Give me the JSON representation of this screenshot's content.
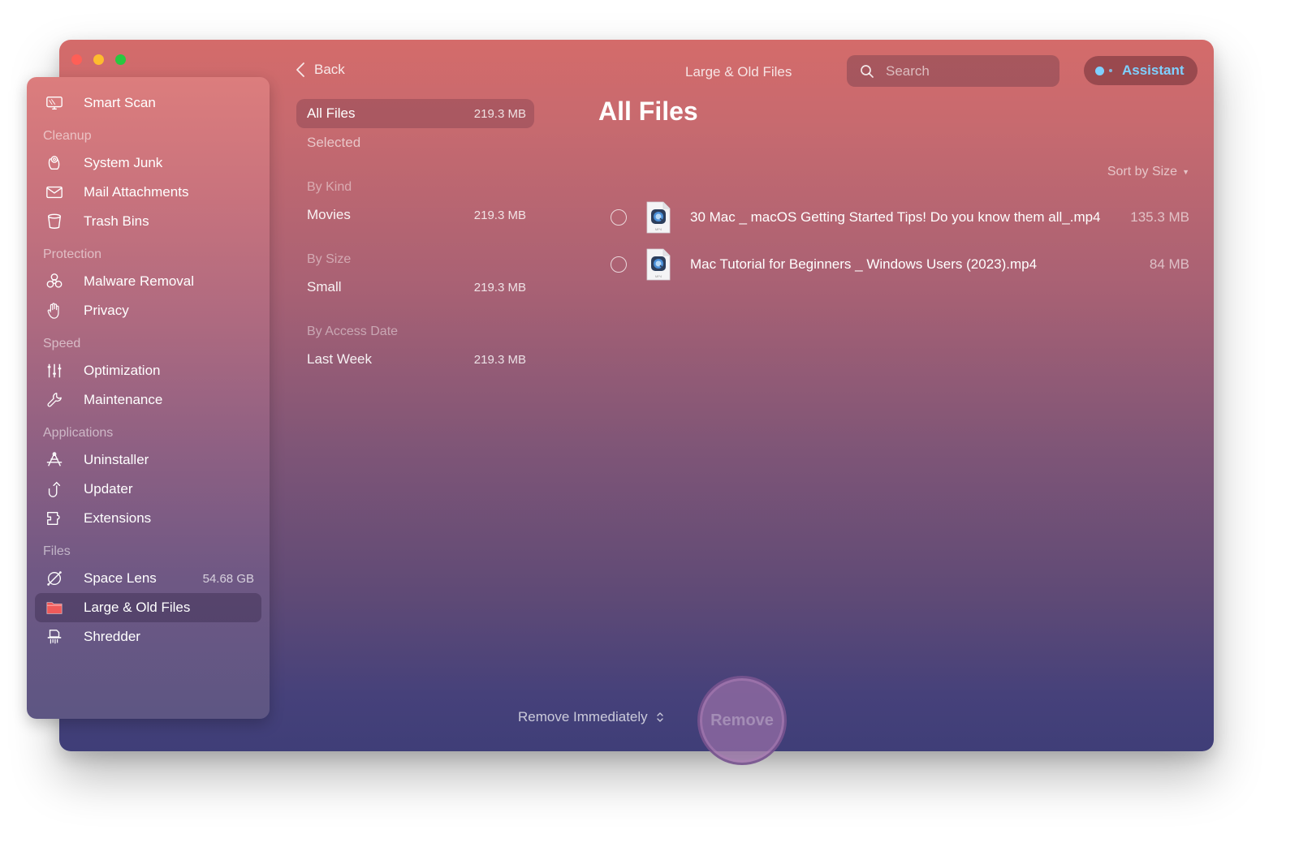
{
  "window": {
    "title": "Large & Old Files",
    "traffic_lights": {
      "close": "#fe5f57",
      "minimize": "#febc2e",
      "zoom": "#28c840"
    }
  },
  "topbar": {
    "back_label": "Back",
    "search_placeholder": "Search",
    "search_value": "",
    "assistant_label": "Assistant",
    "assistant_color": "#7fd0ff"
  },
  "sidebar": {
    "top_item": {
      "label": "Smart Scan",
      "icon": "monitor-scan-icon"
    },
    "sections": [
      {
        "title": "Cleanup",
        "items": [
          {
            "label": "System Junk",
            "icon": "system-junk-icon"
          },
          {
            "label": "Mail Attachments",
            "icon": "mail-icon"
          },
          {
            "label": "Trash Bins",
            "icon": "trash-bin-icon"
          }
        ]
      },
      {
        "title": "Protection",
        "items": [
          {
            "label": "Malware Removal",
            "icon": "biohazard-icon"
          },
          {
            "label": "Privacy",
            "icon": "hand-icon"
          }
        ]
      },
      {
        "title": "Speed",
        "items": [
          {
            "label": "Optimization",
            "icon": "sliders-icon"
          },
          {
            "label": "Maintenance",
            "icon": "wrench-icon"
          }
        ]
      },
      {
        "title": "Applications",
        "items": [
          {
            "label": "Uninstaller",
            "icon": "uninstaller-icon"
          },
          {
            "label": "Updater",
            "icon": "updater-arrow-icon"
          },
          {
            "label": "Extensions",
            "icon": "puzzle-extension-icon"
          }
        ]
      },
      {
        "title": "Files",
        "items": [
          {
            "label": "Space Lens",
            "icon": "planet-icon",
            "value": "54.68 GB"
          },
          {
            "label": "Large & Old Files",
            "icon": "folder-icon",
            "active": true
          },
          {
            "label": "Shredder",
            "icon": "shredder-icon"
          }
        ]
      }
    ]
  },
  "categories": {
    "top": [
      {
        "label": "All Files",
        "size": "219.3 MB",
        "active": true
      },
      {
        "label": "Selected",
        "size": ""
      }
    ],
    "groups": [
      {
        "title": "By Kind",
        "items": [
          {
            "label": "Movies",
            "size": "219.3 MB"
          }
        ]
      },
      {
        "title": "By Size",
        "items": [
          {
            "label": "Small",
            "size": "219.3 MB"
          }
        ]
      },
      {
        "title": "By Access Date",
        "items": [
          {
            "label": "Last Week",
            "size": "219.3 MB"
          }
        ]
      }
    ]
  },
  "content": {
    "title": "All Files",
    "sort_label": "Sort by Size",
    "files": [
      {
        "name": "30 Mac _ macOS Getting Started Tips! Do you know them all_.mp4",
        "size": "135.3 MB",
        "type_label": "MP4",
        "selected": false
      },
      {
        "name": "Mac Tutorial for Beginners _ Windows Users (2023).mp4",
        "size": "84 MB",
        "type_label": "MP4",
        "selected": false
      }
    ]
  },
  "footer": {
    "remove_mode": "Remove Immediately",
    "remove_button": "Remove"
  }
}
